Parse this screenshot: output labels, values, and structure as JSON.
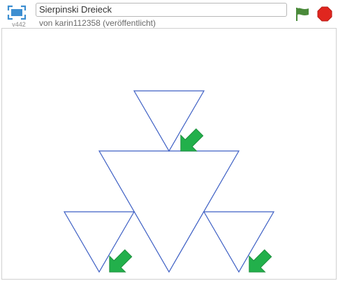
{
  "project": {
    "title": "Sierpinski Dreieck",
    "author": "von karin112358 (veröffentlicht)",
    "version": "v442"
  },
  "icons": {
    "fullscreen": "fullscreen-icon",
    "green_flag": "green-flag-icon",
    "stop": "stop-sign-icon",
    "sprite": "green-arrow-sprite"
  },
  "colors": {
    "triangle_stroke": "#3d5fc4",
    "sprite_fill": "#22b04b",
    "flag": "#4a8a3a",
    "stop": "#e0261f",
    "fullscreen": "#3d8fd1"
  }
}
